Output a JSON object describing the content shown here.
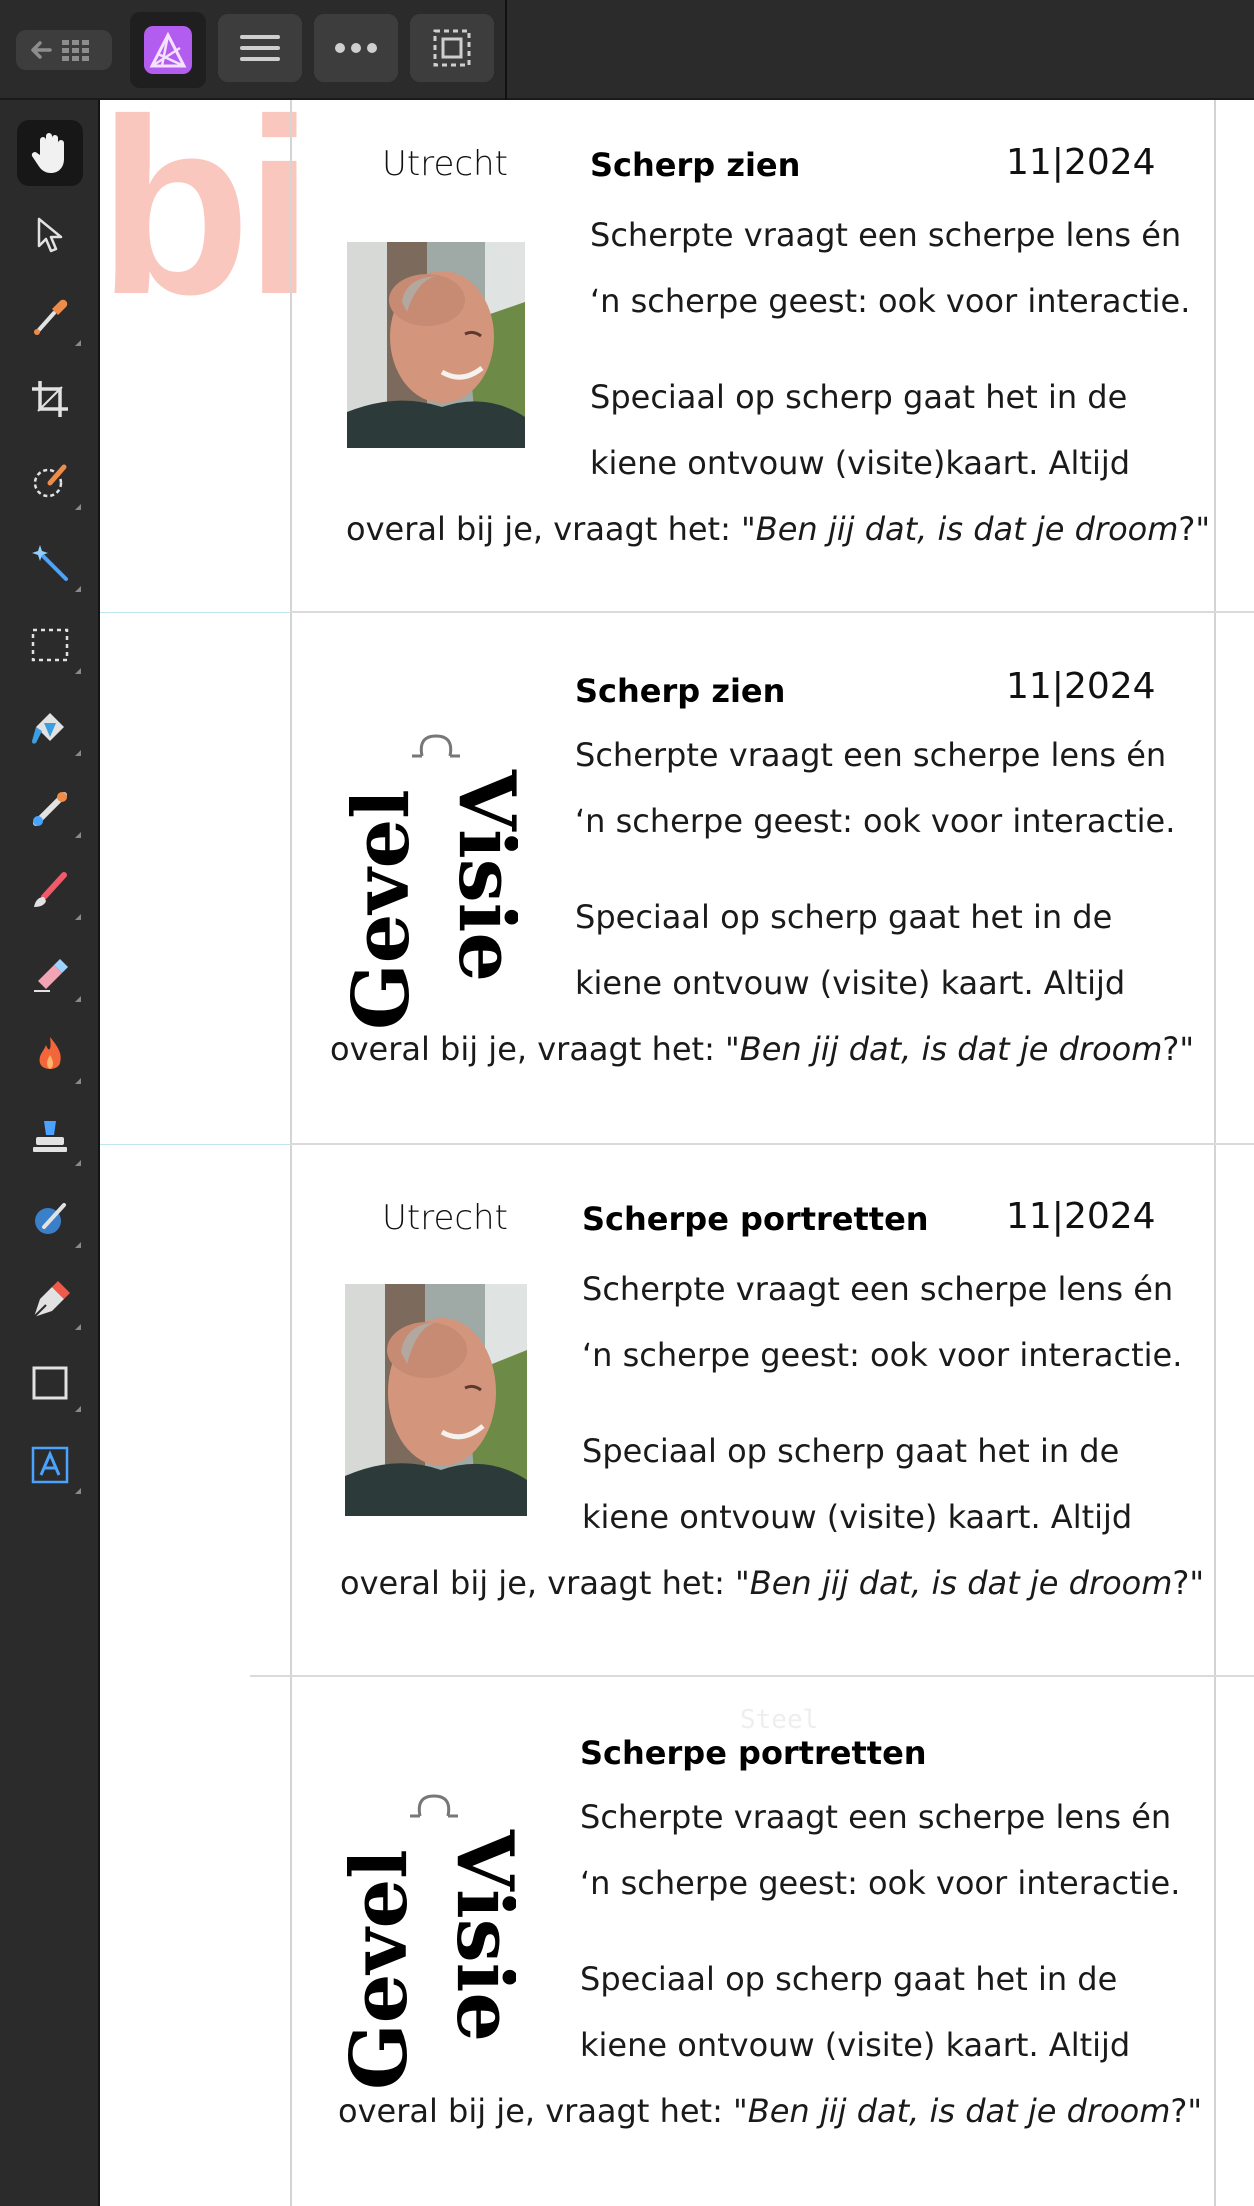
{
  "toolbar": {
    "back_icon": "back-arrow-grid-icon",
    "app_icon": "affinity-photo-icon",
    "menu_icon": "hamburger-menu-icon",
    "more_icon": "more-dots-icon",
    "selection_icon": "selection-mode-icon"
  },
  "tools": [
    {
      "name": "hand-tool",
      "icon": "hand-icon",
      "active": true
    },
    {
      "name": "move-tool",
      "icon": "pointer-icon"
    },
    {
      "name": "color-picker-tool",
      "icon": "eyedropper-icon"
    },
    {
      "name": "crop-tool",
      "icon": "crop-icon"
    },
    {
      "name": "selection-brush-tool",
      "icon": "selection-brush-icon"
    },
    {
      "name": "flood-select-tool",
      "icon": "magic-wand-icon"
    },
    {
      "name": "marquee-tool",
      "icon": "marquee-icon"
    },
    {
      "name": "flood-fill-tool",
      "icon": "paint-bucket-icon"
    },
    {
      "name": "gradient-tool",
      "icon": "gradient-icon"
    },
    {
      "name": "paint-brush-tool",
      "icon": "paint-brush-icon"
    },
    {
      "name": "erase-brush-tool",
      "icon": "eraser-icon"
    },
    {
      "name": "dodge-burn-tool",
      "icon": "flame-icon"
    },
    {
      "name": "clone-tool",
      "icon": "clone-stamp-icon"
    },
    {
      "name": "retouch-tool",
      "icon": "retouch-icon"
    },
    {
      "name": "pen-tool",
      "icon": "pen-nib-icon"
    },
    {
      "name": "rectangle-tool",
      "icon": "rectangle-icon"
    },
    {
      "name": "text-tool",
      "icon": "artistic-text-icon"
    }
  ],
  "canvas": {
    "background_letters": "bi",
    "accent_color": "#f9c7bd"
  },
  "cards": [
    {
      "city": "Utrecht",
      "title": "Scherp zien",
      "date": "11|2024",
      "p1_line1": "Scherpte vraagt een scherpe lens én",
      "p1_line2": "‘n scherpe geest: ook voor interactie.",
      "p2_line1": "Speciaal op scherp gaat het in de",
      "p2_line2": "kiene ontvouw (visite)kaart.  Altijd",
      "p3_start": "overal bij je, vraagt het: ",
      "p3_italic": "\"Ben jij dat, is dat je droom",
      "p3_end": "?\""
    },
    {
      "city": "",
      "title": "Scherp zien",
      "date": "11|2024",
      "p1_line1": "Scherpte vraagt een scherpe lens én",
      "p1_line2": "‘n scherpe geest: ook voor interactie.",
      "p2_line1": "Speciaal op scherp gaat het in de",
      "p2_line2": "kiene ontvouw (visite) kaart.  Altijd",
      "p3_start": "overal bij je, vraagt het: \"",
      "p3_italic": "Ben jij dat, is dat je droom",
      "p3_end": "?\""
    },
    {
      "city": "Utrecht",
      "title": "Scherpe portretten",
      "date": "11|2024",
      "p1_line1": "Scherpte vraagt een scherpe lens én",
      "p1_line2": "‘n scherpe geest: ook voor interactie.",
      "p2_line1": "Speciaal op scherp gaat het in de",
      "p2_line2": "kiene ontvouw (visite) kaart.  Altijd",
      "p3_start": "overal bij je, vraagt het: \"",
      "p3_italic": "Ben jij dat, is dat je droom",
      "p3_end": "?\""
    },
    {
      "city": "",
      "title": "Scherpe portretten",
      "date": "",
      "p1_line1": "Scherpte vraagt een scherpe lens én",
      "p1_line2": "‘n scherpe geest: ook voor interactie.",
      "p2_line1": "Speciaal op scherp gaat het in de",
      "p2_line2": "kiene ontvouw (visite) kaart.  Altijd",
      "p3_start": "overal bij je, vraagt het: \"",
      "p3_italic": "Ben jij dat, is dat je droom",
      "p3_end": "?\""
    }
  ],
  "logo": {
    "word1": "Gevel",
    "word2": "Visie"
  }
}
